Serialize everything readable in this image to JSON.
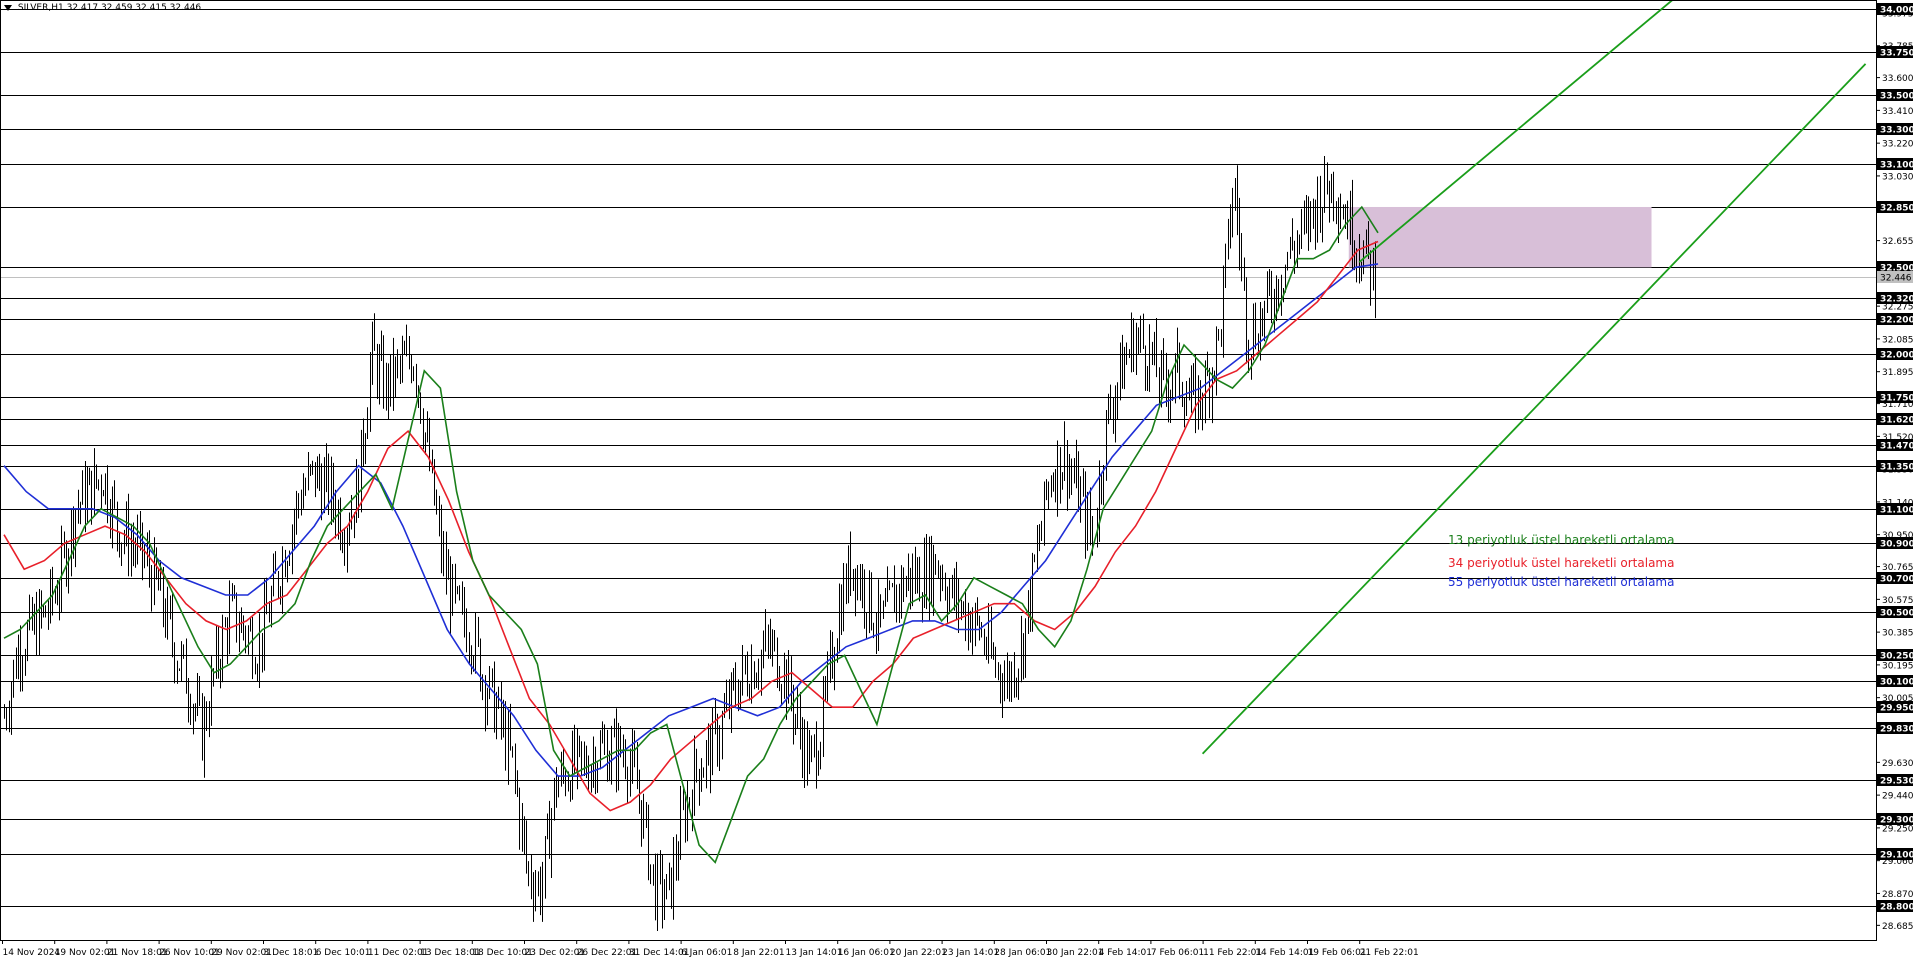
{
  "header": {
    "symbol": "SILVER,H1",
    "ohlc": "32.417 32.459 32.415 32.446"
  },
  "legend": [
    {
      "label": "13 periyotluk üstel hareketli ortalama",
      "color": "#1a7f1a"
    },
    {
      "label": "34 periyotluk üstel hareketli ortalama",
      "color": "#e8202a"
    },
    {
      "label": "55 periyotluk üstel hareketli ortalama",
      "color": "#1f2fd6"
    }
  ],
  "chart_data": {
    "type": "line",
    "title": "",
    "xlabel": "",
    "ylabel": "",
    "ylim": [
      28.6,
      34.05
    ],
    "x_ticks": [
      "14 Nov 2024",
      "19 Nov 02:01",
      "21 Nov 18:01",
      "26 Nov 10:01",
      "29 Nov 02:01",
      "3 Dec 18:01",
      "6 Dec 10:01",
      "11 Dec 02:01",
      "13 Dec 18:01",
      "18 Dec 10:01",
      "23 Dec 02:01",
      "26 Dec 22:01",
      "31 Dec 14:01",
      "6 Jan 06:01",
      "8 Jan 22:01",
      "13 Jan 14:01",
      "16 Jan 06:01",
      "20 Jan 22:01",
      "23 Jan 14:01",
      "28 Jan 06:01",
      "30 Jan 22:01",
      "4 Feb 14:01",
      "7 Feb 06:01",
      "11 Feb 22:01",
      "14 Feb 14:01",
      "19 Feb 06:01",
      "21 Feb 22:01"
    ],
    "y_ticks": [
      "33.975",
      "33.785",
      "33.600",
      "33.410",
      "33.220",
      "33.030",
      "32.845",
      "32.655",
      "32.465",
      "32.275",
      "32.085",
      "31.895",
      "31.710",
      "31.520",
      "31.330",
      "31.140",
      "30.950",
      "30.765",
      "30.575",
      "30.385",
      "30.195",
      "30.005",
      "29.820",
      "29.630",
      "29.440",
      "29.250",
      "29.060",
      "28.870",
      "28.685"
    ],
    "levels": [
      "34.000",
      "33.750",
      "33.500",
      "33.300",
      "33.100",
      "32.850",
      "32.500",
      "32.320",
      "32.200",
      "32.000",
      "31.750",
      "31.620",
      "31.470",
      "31.350",
      "31.100",
      "30.900",
      "30.700",
      "30.500",
      "30.250",
      "30.100",
      "29.950",
      "29.830",
      "29.530",
      "29.300",
      "29.100",
      "28.800"
    ],
    "current_price": "32.446",
    "zone": {
      "from_index": 25.8,
      "to_index": 31.6,
      "low": 32.5,
      "high": 32.85,
      "color": "#d8bfd8"
    },
    "channel_color": "#1a9e1a",
    "channel_upper": [
      [
        26.0,
        32.53
      ],
      [
        32.0,
        34.05
      ]
    ],
    "channel_lower": [
      [
        23.0,
        29.68
      ],
      [
        35.7,
        33.68
      ]
    ],
    "closes": [
      29.9,
      30.3,
      30.4,
      30.5,
      30.7,
      31.1,
      31.2,
      31.3,
      31.0,
      30.9,
      30.8,
      30.6,
      30.3,
      30.1,
      29.8,
      30.2,
      30.5,
      30.4,
      30.3,
      30.6,
      30.9,
      31.2,
      31.3,
      31.2,
      31.0,
      31.2,
      32.0,
      31.8,
      31.9,
      32.0,
      31.4,
      30.8,
      30.5,
      30.4,
      30.1,
      29.9,
      29.6,
      29.0,
      28.9,
      29.5,
      29.6,
      29.6,
      29.7,
      29.7,
      29.7,
      29.4,
      28.9,
      28.85,
      29.3,
      29.6,
      29.7,
      29.9,
      30.1,
      30.2,
      30.3,
      30.2,
      29.9,
      29.6,
      29.9,
      30.5,
      30.8,
      30.6,
      30.4,
      30.6,
      30.7,
      30.7,
      30.8,
      30.6,
      30.5,
      30.4,
      30.2,
      30.1,
      30.3,
      30.8,
      31.3,
      31.4,
      31.2,
      30.9,
      31.6,
      31.9,
      32.1,
      32.0,
      31.8,
      31.9,
      31.7,
      31.8,
      32.1,
      33.0,
      32.1,
      32.2,
      32.4,
      32.6,
      32.7,
      32.9,
      33.0,
      32.8,
      32.6,
      32.45
    ],
    "ema13": [
      30.35,
      30.4,
      30.5,
      30.6,
      30.8,
      31.0,
      31.1,
      31.05,
      31.0,
      30.9,
      30.7,
      30.5,
      30.3,
      30.15,
      30.2,
      30.3,
      30.4,
      30.45,
      30.55,
      30.8,
      31.0,
      31.1,
      31.2,
      31.3,
      31.1,
      31.5,
      31.9,
      31.8,
      31.2,
      30.8,
      30.6,
      30.5,
      30.4,
      30.2,
      29.7,
      29.55,
      29.6,
      29.65,
      29.7,
      29.7,
      29.8,
      29.85,
      29.5,
      29.15,
      29.05,
      29.3,
      29.55,
      29.65,
      29.85,
      30.0,
      30.1,
      30.2,
      30.25,
      30.05,
      29.85,
      30.2,
      30.55,
      30.6,
      30.45,
      30.55,
      30.7,
      30.65,
      30.6,
      30.55,
      30.4,
      30.3,
      30.45,
      30.75,
      31.1,
      31.25,
      31.4,
      31.55,
      31.85,
      32.05,
      31.95,
      31.85,
      31.8,
      31.9,
      32.05,
      32.3,
      32.55,
      32.55,
      32.6,
      32.75,
      32.85,
      32.7
    ],
    "ema34": [
      30.95,
      30.75,
      30.8,
      30.9,
      30.95,
      31.0,
      30.95,
      30.85,
      30.7,
      30.55,
      30.45,
      30.4,
      30.45,
      30.55,
      30.6,
      30.75,
      30.9,
      31.0,
      31.2,
      31.45,
      31.55,
      31.4,
      31.15,
      30.85,
      30.6,
      30.3,
      30.0,
      29.85,
      29.65,
      29.45,
      29.35,
      29.4,
      29.5,
      29.65,
      29.75,
      29.85,
      29.95,
      30.0,
      30.1,
      30.15,
      30.05,
      29.95,
      29.95,
      30.1,
      30.2,
      30.35,
      30.4,
      30.45,
      30.5,
      30.55,
      30.55,
      30.45,
      30.4,
      30.5,
      30.65,
      30.85,
      31.0,
      31.2,
      31.45,
      31.7,
      31.85,
      31.9,
      32.0,
      32.1,
      32.2,
      32.3,
      32.45,
      32.6,
      32.65
    ],
    "ema55": [
      31.35,
      31.2,
      31.1,
      31.1,
      31.1,
      31.05,
      30.95,
      30.8,
      30.7,
      30.65,
      30.6,
      30.6,
      30.7,
      30.85,
      31.0,
      31.2,
      31.35,
      31.25,
      31.0,
      30.7,
      30.4,
      30.2,
      30.05,
      29.9,
      29.7,
      29.55,
      29.55,
      29.6,
      29.7,
      29.8,
      29.9,
      29.95,
      30.0,
      29.95,
      29.9,
      29.95,
      30.1,
      30.2,
      30.3,
      30.35,
      30.4,
      30.45,
      30.45,
      30.4,
      30.4,
      30.5,
      30.65,
      30.8,
      31.0,
      31.2,
      31.4,
      31.55,
      31.7,
      31.75,
      31.8,
      31.9,
      32.0,
      32.1,
      32.2,
      32.3,
      32.4,
      32.5,
      32.52
    ]
  }
}
